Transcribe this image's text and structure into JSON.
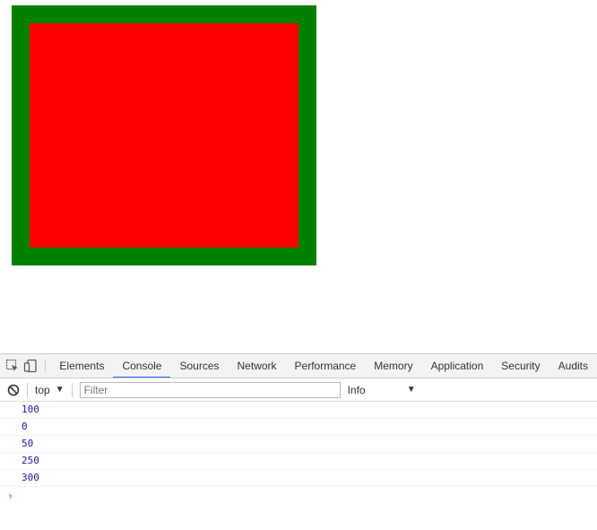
{
  "page": {
    "outer_box_color": "#008000",
    "inner_box_color": "#ff0000"
  },
  "devtools": {
    "icons": [
      "inspect-element-icon",
      "device-toolbar-icon"
    ],
    "tabs": [
      {
        "label": "Elements",
        "active": false
      },
      {
        "label": "Console",
        "active": true
      },
      {
        "label": "Sources",
        "active": false
      },
      {
        "label": "Network",
        "active": false
      },
      {
        "label": "Performance",
        "active": false
      },
      {
        "label": "Memory",
        "active": false
      },
      {
        "label": "Application",
        "active": false
      },
      {
        "label": "Security",
        "active": false
      },
      {
        "label": "Audits",
        "active": false
      }
    ],
    "accent_color": "#1a73e8",
    "console": {
      "context": "top",
      "filter_placeholder": "Filter",
      "filter_value": "",
      "level": "Info",
      "messages": [
        "100",
        "0",
        "50",
        "250",
        "300"
      ],
      "message_color": "#1a1aa6",
      "prompt": "›"
    }
  }
}
